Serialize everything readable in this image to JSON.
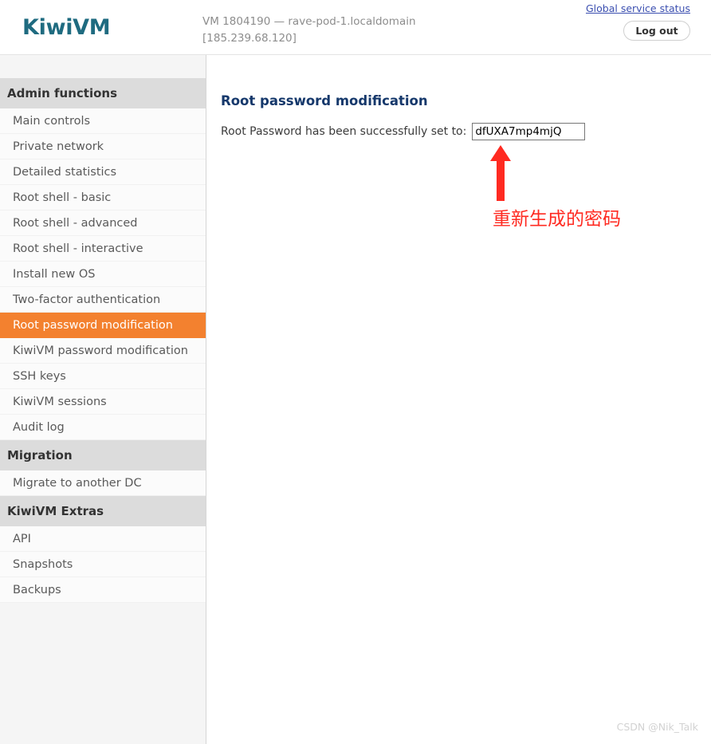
{
  "header": {
    "brand": "KiwiVM",
    "vm_line1": "VM 1804190 — rave-pod-1.localdomain",
    "vm_line2": "[185.239.68.120]",
    "global_status_link": "Global service status",
    "logout_label": "Log out",
    "brand_color": "#1f6b80",
    "link_color": "#3b4fb0"
  },
  "sidebar": {
    "sections": [
      {
        "title": "Admin functions",
        "items": [
          {
            "label": "Main controls",
            "active": false
          },
          {
            "label": "Private network",
            "active": false
          },
          {
            "label": "Detailed statistics",
            "active": false
          },
          {
            "label": "Root shell - basic",
            "active": false
          },
          {
            "label": "Root shell - advanced",
            "active": false
          },
          {
            "label": "Root shell - interactive",
            "active": false
          },
          {
            "label": "Install new OS",
            "active": false
          },
          {
            "label": "Two-factor authentication",
            "active": false
          },
          {
            "label": "Root password modification",
            "active": true
          },
          {
            "label": "KiwiVM password modification",
            "active": false
          },
          {
            "label": "SSH keys",
            "active": false
          },
          {
            "label": "KiwiVM sessions",
            "active": false
          },
          {
            "label": "Audit log",
            "active": false
          }
        ]
      },
      {
        "title": "Migration",
        "items": [
          {
            "label": "Migrate to another DC",
            "active": false
          }
        ]
      },
      {
        "title": "KiwiVM Extras",
        "items": [
          {
            "label": "API",
            "active": false
          },
          {
            "label": "Snapshots",
            "active": false
          },
          {
            "label": "Backups",
            "active": false
          }
        ]
      }
    ],
    "active_bg": "#f3812f",
    "section_bg": "#dcdcdc"
  },
  "main": {
    "page_title": "Root password modification",
    "form_label": "Root Password has been successfully set to:",
    "password_value": "dfUXA7mp4mjQ",
    "title_color": "#15386b"
  },
  "annotation": {
    "text": "重新生成的密码",
    "color": "#ff2a21",
    "arrow_direction": "up"
  },
  "watermark": {
    "text": "CSDN @Nik_Talk"
  }
}
